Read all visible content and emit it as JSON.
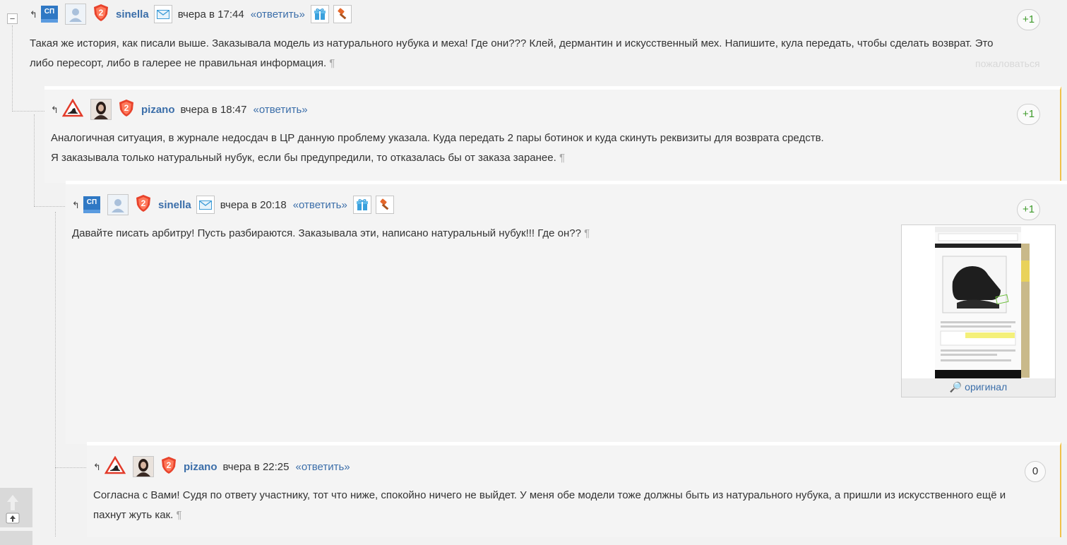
{
  "comments": [
    {
      "org_badge": "СП",
      "nick": "sinella",
      "time": "вчера в 17:44",
      "reply": "«ответить»",
      "vote": "+1",
      "text_lines": [
        "Такая же история, как писали выше. Заказывала модель из натурального нубука и меха! Где они??? Клей, дермантин и искусственный мех. Напишите, кула передать, чтобы сделать возврат. Это",
        "либо пересорт, либо в галерее не правильная информация."
      ],
      "complain": "пожаловаться",
      "rank": "2"
    },
    {
      "nick": "pizano",
      "time": "вчера в 18:47",
      "reply": "«ответить»",
      "vote": "+1",
      "text_lines": [
        "Аналогичная ситуация, в журнале недосдач в ЦР данную проблему указала. Куда передать 2 пары ботинок и куда скинуть реквизиты для возврата средств.",
        "Я заказывала только натуральный нубук, если бы предупредили, то отказалась бы от заказа заранее."
      ],
      "rank": "2"
    },
    {
      "org_badge": "СП",
      "nick": "sinella",
      "time": "вчера в 20:18",
      "reply": "«ответить»",
      "vote": "+1",
      "text_lines": [
        "Давайте писать арбитру! Пусть разбираются. Заказывала эти, написано натуральный нубук!!! Где он??"
      ],
      "attachment_link": "оригинал",
      "rank": "2"
    },
    {
      "nick": "pizano",
      "time": "вчера в 22:25",
      "reply": "«ответить»",
      "vote": "0",
      "text_lines": [
        "Согласна с Вами! Судя по ответу участнику, тот что ниже, спокойно ничего не выйдет. У меня обе модели тоже должны быть из натурального нубука, а пришли из искусственного ещё и",
        "пахнут жуть как."
      ],
      "rank": "2"
    }
  ],
  "pilcrow": "¶",
  "collapse": "−",
  "reply_arrow": "↰",
  "colors": {
    "link": "#3b6ea9",
    "vote_green": "#3d9a2a",
    "highlight": "#f0c24b"
  }
}
